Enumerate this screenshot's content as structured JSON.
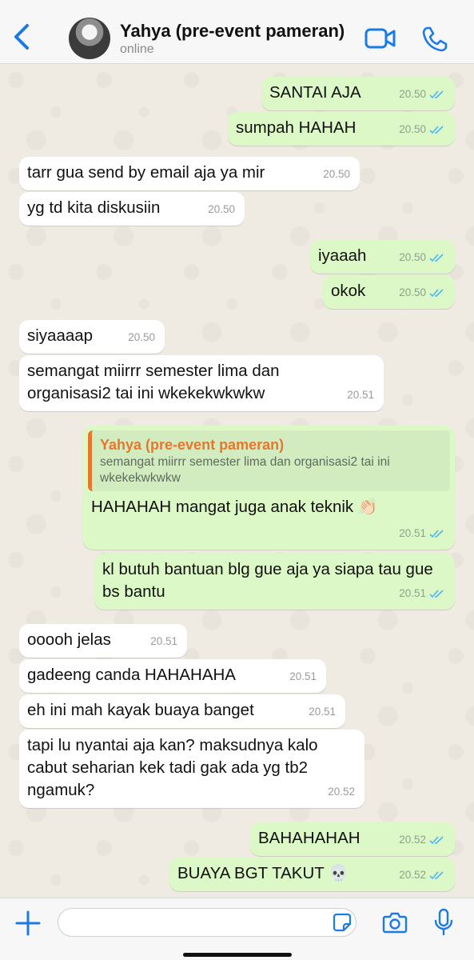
{
  "header": {
    "back_icon": "chevron-left-icon",
    "contact_name": "Yahya (pre-event pameran)",
    "status": "online",
    "video_icon": "video-camera-icon",
    "call_icon": "phone-icon"
  },
  "messages": [
    {
      "dir": "out",
      "text": "SANTAI AJA",
      "time": "20.50",
      "read": true
    },
    {
      "dir": "out",
      "text": "sumpah HAHAH",
      "time": "20.50",
      "read": true
    },
    {
      "dir": "in",
      "text": "tarr gua send by email aja ya mir",
      "time": "20.50"
    },
    {
      "dir": "in",
      "text": "yg td kita diskusiin",
      "time": "20.50"
    },
    {
      "dir": "out",
      "text": "iyaaah",
      "time": "20.50",
      "read": true
    },
    {
      "dir": "out",
      "text": "okok",
      "time": "20.50",
      "read": true
    },
    {
      "dir": "in",
      "text": "siyaaaap",
      "time": "20.50"
    },
    {
      "dir": "in",
      "text": "semangat miirrr semester lima dan organisasi2 tai ini wkekekwkwkw",
      "time": "20.51"
    },
    {
      "dir": "out",
      "quote_author": "Yahya (pre-event pameran)",
      "quote_text": "semangat miirrr semester lima dan organisasi2 tai ini wkekekwkwkw",
      "text": "HAHAHAH mangat juga anak teknik",
      "emoji": "👏🏻",
      "time": "20.51",
      "read": true
    },
    {
      "dir": "out",
      "text": "kl butuh bantuan blg gue aja ya siapa tau gue bs bantu",
      "time": "20.51",
      "read": true
    },
    {
      "dir": "in",
      "text": "ooooh jelas",
      "time": "20.51"
    },
    {
      "dir": "in",
      "text": "gadeeng canda HAHAHAHA",
      "time": "20.51"
    },
    {
      "dir": "in",
      "text": "eh ini mah kayak buaya banget",
      "time": "20.51"
    },
    {
      "dir": "in",
      "text": "tapi lu nyantai aja kan? maksudnya kalo cabut seharian kek tadi gak ada yg tb2 ngamuk?",
      "time": "20.52"
    },
    {
      "dir": "out",
      "text": "BAHAHAHAH",
      "time": "20.52",
      "read": true
    },
    {
      "dir": "out",
      "text": "BUAYA BGT TAKUT",
      "emoji": "💀",
      "time": "20.52",
      "read": true
    }
  ],
  "footer": {
    "plus_icon": "plus-icon",
    "input_value": "",
    "sticker_icon": "sticker-icon",
    "camera_icon": "camera-icon",
    "mic_icon": "microphone-icon"
  },
  "colors": {
    "accent": "#1a7ae6",
    "outgoing_bubble": "#dcf8c6",
    "incoming_bubble": "#ffffff",
    "quote_author": "#e8762b",
    "read_ticks": "#4fb5ec",
    "chat_background": "#efeae2"
  }
}
